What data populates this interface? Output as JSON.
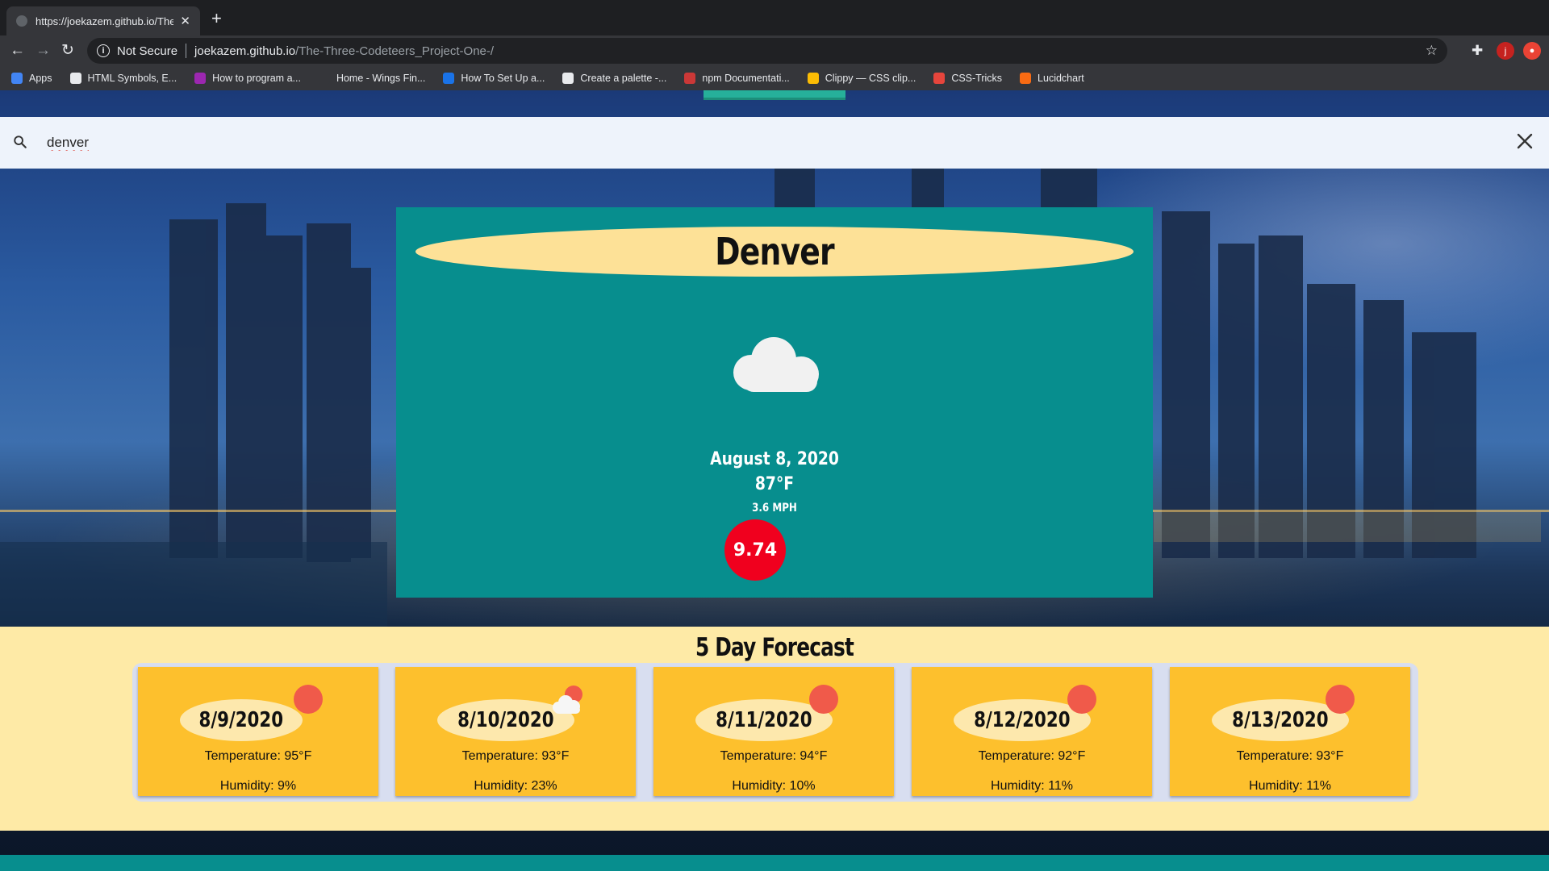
{
  "browser": {
    "tab_title": "https://joekazem.github.io/The",
    "new_tab_label": "+",
    "security_label": "Not Secure",
    "url_host": "joekazem.github.io",
    "url_path": "/The-Three-Codeteers_Project-One-/",
    "profile_initial": "j",
    "bookmarks": [
      {
        "label": "Apps",
        "icon_color": "#4285f4"
      },
      {
        "label": "HTML Symbols, E...",
        "icon_color": "#e8eaed"
      },
      {
        "label": "How to program a...",
        "icon_color": "#9c27b0"
      },
      {
        "label": "Home - Wings Fin...",
        "icon_color": "#35363a"
      },
      {
        "label": "How To Set Up a...",
        "icon_color": "#1a73e8"
      },
      {
        "label": "Create a palette -...",
        "icon_color": "#e8eaed"
      },
      {
        "label": "npm Documentati...",
        "icon_color": "#cb3837"
      },
      {
        "label": "Clippy — CSS clip...",
        "icon_color": "#fbbc04"
      },
      {
        "label": "CSS-Tricks",
        "icon_color": "#e6453c"
      },
      {
        "label": "Lucidchart",
        "icon_color": "#f96b13"
      }
    ]
  },
  "search": {
    "value": "denver",
    "icon": "search-icon",
    "clear_icon": "close-icon"
  },
  "current": {
    "city": "Denver",
    "icon": "cloud-icon",
    "date": "August 8, 2020",
    "temperature": "87°F",
    "wind": "3.6 MPH",
    "uv_index": "9.74",
    "uv_color": "#f0001e"
  },
  "forecast": {
    "title": "5 Day Forecast",
    "days": [
      {
        "date": "8/9/2020",
        "temperature": "Temperature: 95°F",
        "humidity": "Humidity: 9%",
        "icon": "sun-icon"
      },
      {
        "date": "8/10/2020",
        "temperature": "Temperature: 93°F",
        "humidity": "Humidity: 23%",
        "icon": "partly-cloudy-icon"
      },
      {
        "date": "8/11/2020",
        "temperature": "Temperature: 94°F",
        "humidity": "Humidity: 10%",
        "icon": "sun-icon"
      },
      {
        "date": "8/12/2020",
        "temperature": "Temperature: 92°F",
        "humidity": "Humidity: 11%",
        "icon": "sun-icon"
      },
      {
        "date": "8/13/2020",
        "temperature": "Temperature: 93°F",
        "humidity": "Humidity: 11%",
        "icon": "sun-icon"
      }
    ]
  },
  "colors": {
    "card_teal": "#078e8e",
    "city_oval": "#fde197",
    "forecast_bg": "#feeaa6",
    "forecast_card": "#fdc02d",
    "sun": "#f05a4a"
  }
}
